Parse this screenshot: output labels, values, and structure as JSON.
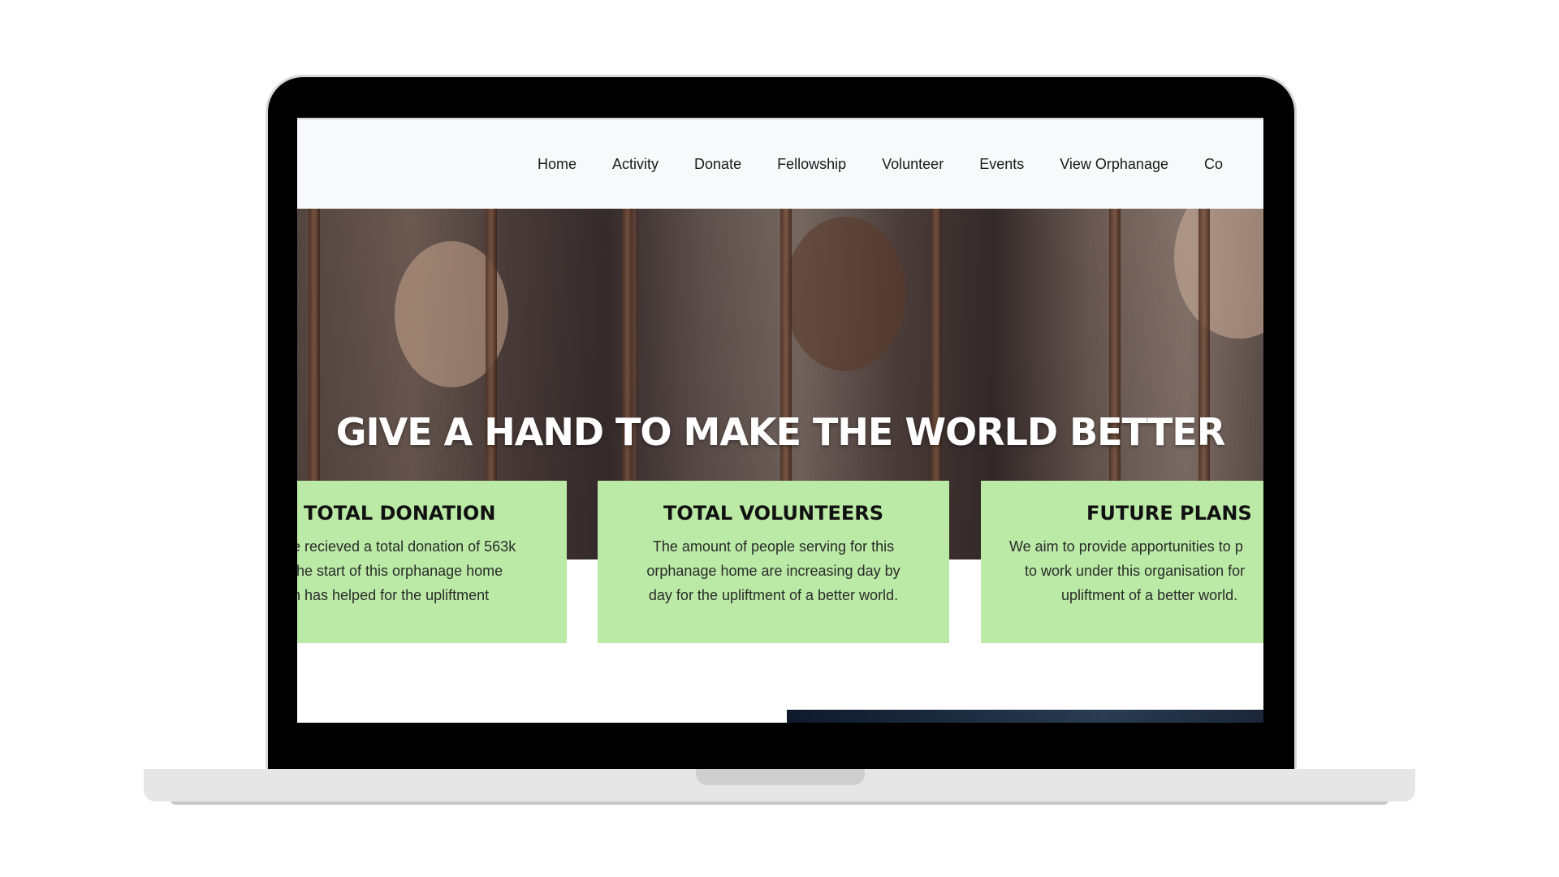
{
  "nav": {
    "items": [
      "Home",
      "Activity",
      "Donate",
      "Fellowship",
      "Volunteer",
      "Events",
      "View Orphanage",
      "Co"
    ]
  },
  "hero": {
    "title": "GIVE A HAND TO MAKE THE WORLD BETTER"
  },
  "cards": [
    {
      "title": "TOTAL DONATION",
      "lines": [
        "e recieved a total donation of 563k",
        "the start of this orphanage home",
        "h has helped for the upliftment"
      ]
    },
    {
      "title": "TOTAL VOLUNTEERS",
      "lines": [
        "The amount of people serving for this",
        "orphanage home are increasing day by",
        "day for the upliftment of a better world."
      ]
    },
    {
      "title": "FUTURE PLANS",
      "lines": [
        "We aim to provide apportunities to p",
        "to work under this organisation for",
        "upliftment of a better world."
      ]
    }
  ],
  "colors": {
    "card_bg": "#bbeaa6",
    "navbar_bg": "#f8f9fa"
  }
}
